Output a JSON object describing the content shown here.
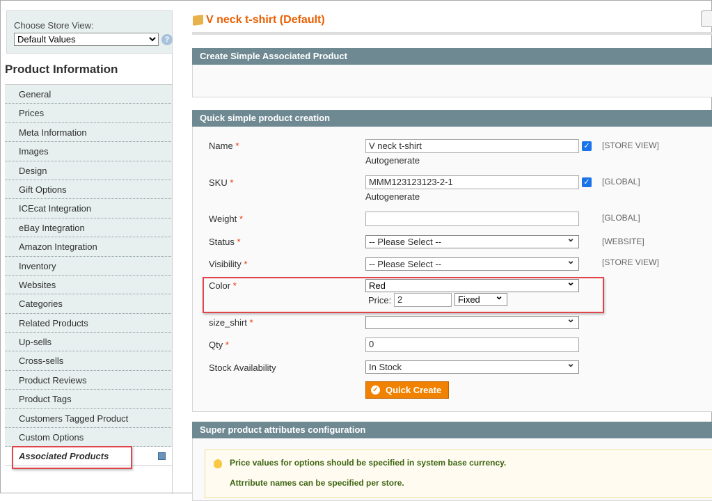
{
  "store_view": {
    "label": "Choose Store View:",
    "selected": "Default Values",
    "help": "?"
  },
  "sidebar": {
    "title": "Product Information",
    "items": [
      {
        "label": "General"
      },
      {
        "label": "Prices"
      },
      {
        "label": "Meta Information"
      },
      {
        "label": "Images"
      },
      {
        "label": "Design"
      },
      {
        "label": "Gift Options"
      },
      {
        "label": "ICEcat Integration"
      },
      {
        "label": "eBay Integration"
      },
      {
        "label": "Amazon Integration"
      },
      {
        "label": "Inventory"
      },
      {
        "label": "Websites"
      },
      {
        "label": "Categories"
      },
      {
        "label": "Related Products"
      },
      {
        "label": "Up-sells"
      },
      {
        "label": "Cross-sells"
      },
      {
        "label": "Product Reviews"
      },
      {
        "label": "Product Tags"
      },
      {
        "label": "Customers Tagged Product"
      },
      {
        "label": "Custom Options"
      },
      {
        "label": "Associated Products",
        "active": true
      }
    ]
  },
  "header": {
    "title": "V neck t-shirt (Default)"
  },
  "panels": {
    "create": "Create Simple Associated Product",
    "quick": "Quick simple product creation",
    "super": "Super product attributes configuration"
  },
  "form": {
    "name": {
      "label": "Name",
      "value": "V  neck t-shirt",
      "auto": "Autogenerate",
      "scope": "[STORE VIEW]",
      "checked": true
    },
    "sku": {
      "label": "SKU",
      "value": "MMM123123123-2-1",
      "auto": "Autogenerate",
      "scope": "[GLOBAL]",
      "checked": true
    },
    "weight": {
      "label": "Weight",
      "value": "",
      "scope": "[GLOBAL]"
    },
    "status": {
      "label": "Status",
      "value": "-- Please Select --",
      "scope": "[WEBSITE]"
    },
    "visibility": {
      "label": "Visibility",
      "value": "-- Please Select --",
      "scope": "[STORE VIEW]"
    },
    "color": {
      "label": "Color",
      "value": "Red",
      "price_label": "Price:",
      "price": "2",
      "price_type": "Fixed"
    },
    "size": {
      "label": "size_shirt",
      "value": ""
    },
    "qty": {
      "label": "Qty",
      "value": "0"
    },
    "stock": {
      "label": "Stock Availability",
      "value": "In Stock"
    },
    "required": "*",
    "button": "Quick Create"
  },
  "notice": {
    "line1": "Price values for options should be specified in system base currency.",
    "line2": "Attrribute names can be specified per store."
  },
  "colors": {
    "accent": "#eb5e00",
    "header": "#6f8992",
    "highlight": "#e0454b",
    "button": "#f18200"
  }
}
